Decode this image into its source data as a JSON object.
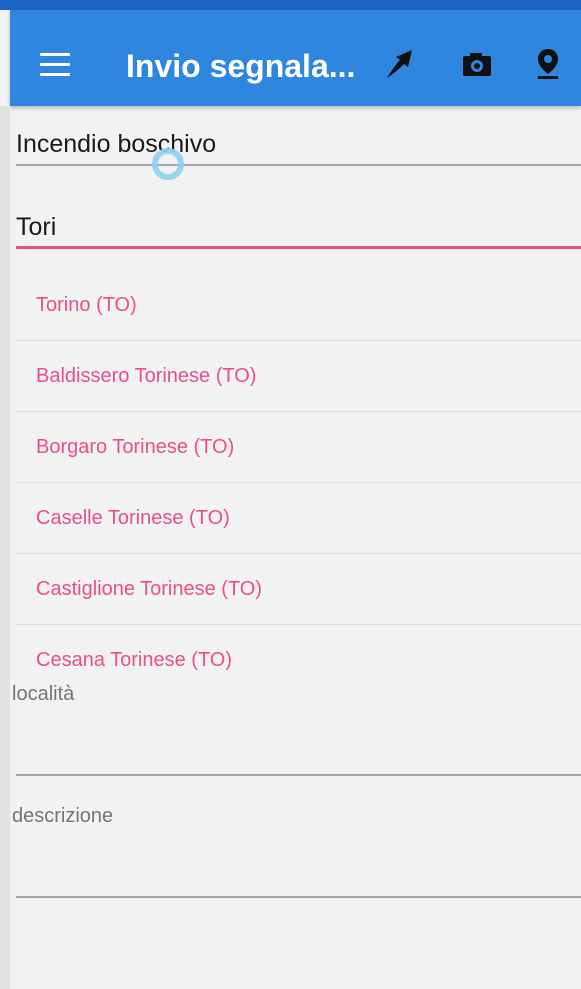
{
  "appbar": {
    "title": "Invio segnala...",
    "icons": [
      "menu-icon",
      "upload-arrow-icon",
      "camera-icon",
      "location-pin-icon"
    ],
    "background": "#2f86df"
  },
  "form": {
    "category_value": "Incendio boschivo",
    "city_value": "Tori",
    "locality_label": "località",
    "description_label": "descrizione"
  },
  "autocomplete": {
    "items": [
      "Torino (TO)",
      "Baldissero Torinese (TO)",
      "Borgaro Torinese (TO)",
      "Caselle Torinese (TO)",
      "Castiglione Torinese (TO)",
      "Cesana Torinese (TO)"
    ]
  },
  "colors": {
    "accent": "#e84f8c",
    "appbar": "#2f86df",
    "background": "#f2f2f2"
  }
}
